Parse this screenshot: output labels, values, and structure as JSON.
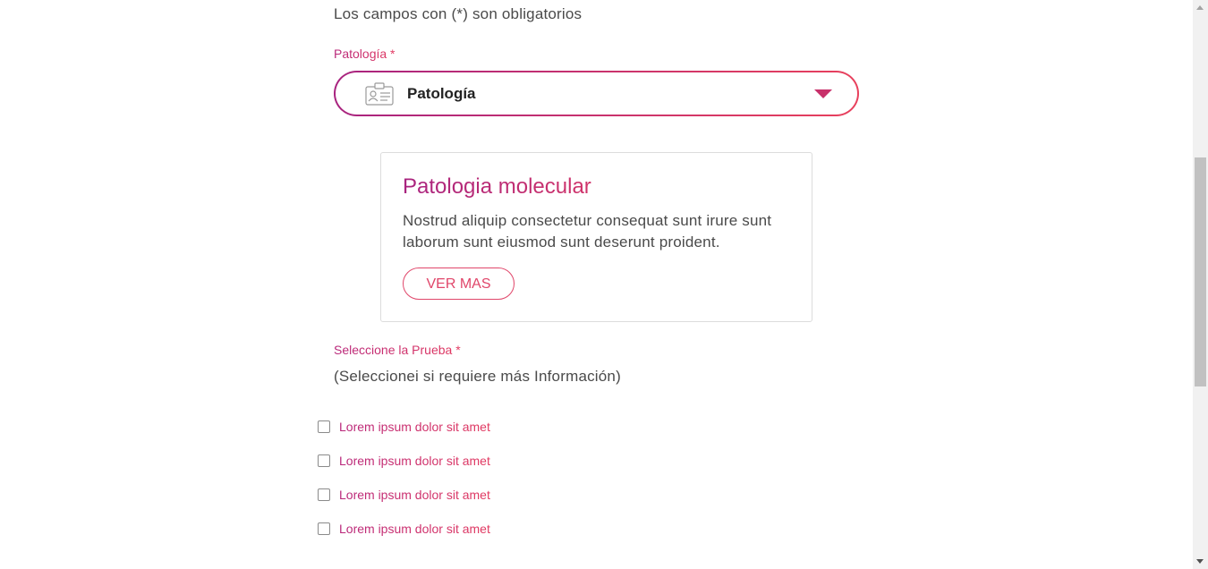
{
  "form": {
    "required_note": "Los campos con (*) son obligatorios",
    "patologia_label": "Patología *",
    "patologia_select": {
      "value": "Patología",
      "icon": "id-card-icon",
      "caret_icon": "caret-down-icon"
    },
    "card": {
      "title": "Patologia molecular",
      "text": "Nostrud aliquip consectetur consequat sunt irure sunt laborum sunt eiusmod sunt deserunt proident.",
      "button_label": "VER MAS"
    },
    "prueba_label": "Seleccione la Prueba *",
    "prueba_subtitle": "(Seleccionei si requiere más Información)",
    "options": [
      {
        "label": "Lorem ipsum dolor sit amet",
        "checked": false
      },
      {
        "label": "Lorem ipsum dolor sit amet",
        "checked": false
      },
      {
        "label": "Lorem ipsum dolor sit amet",
        "checked": false
      },
      {
        "label": "Lorem ipsum dolor sit amet",
        "checked": false
      }
    ]
  },
  "colors": {
    "accent_start": "#a8237f",
    "accent_end": "#e8405c",
    "text": "#4a4a4a",
    "border": "#dcdcdc"
  }
}
